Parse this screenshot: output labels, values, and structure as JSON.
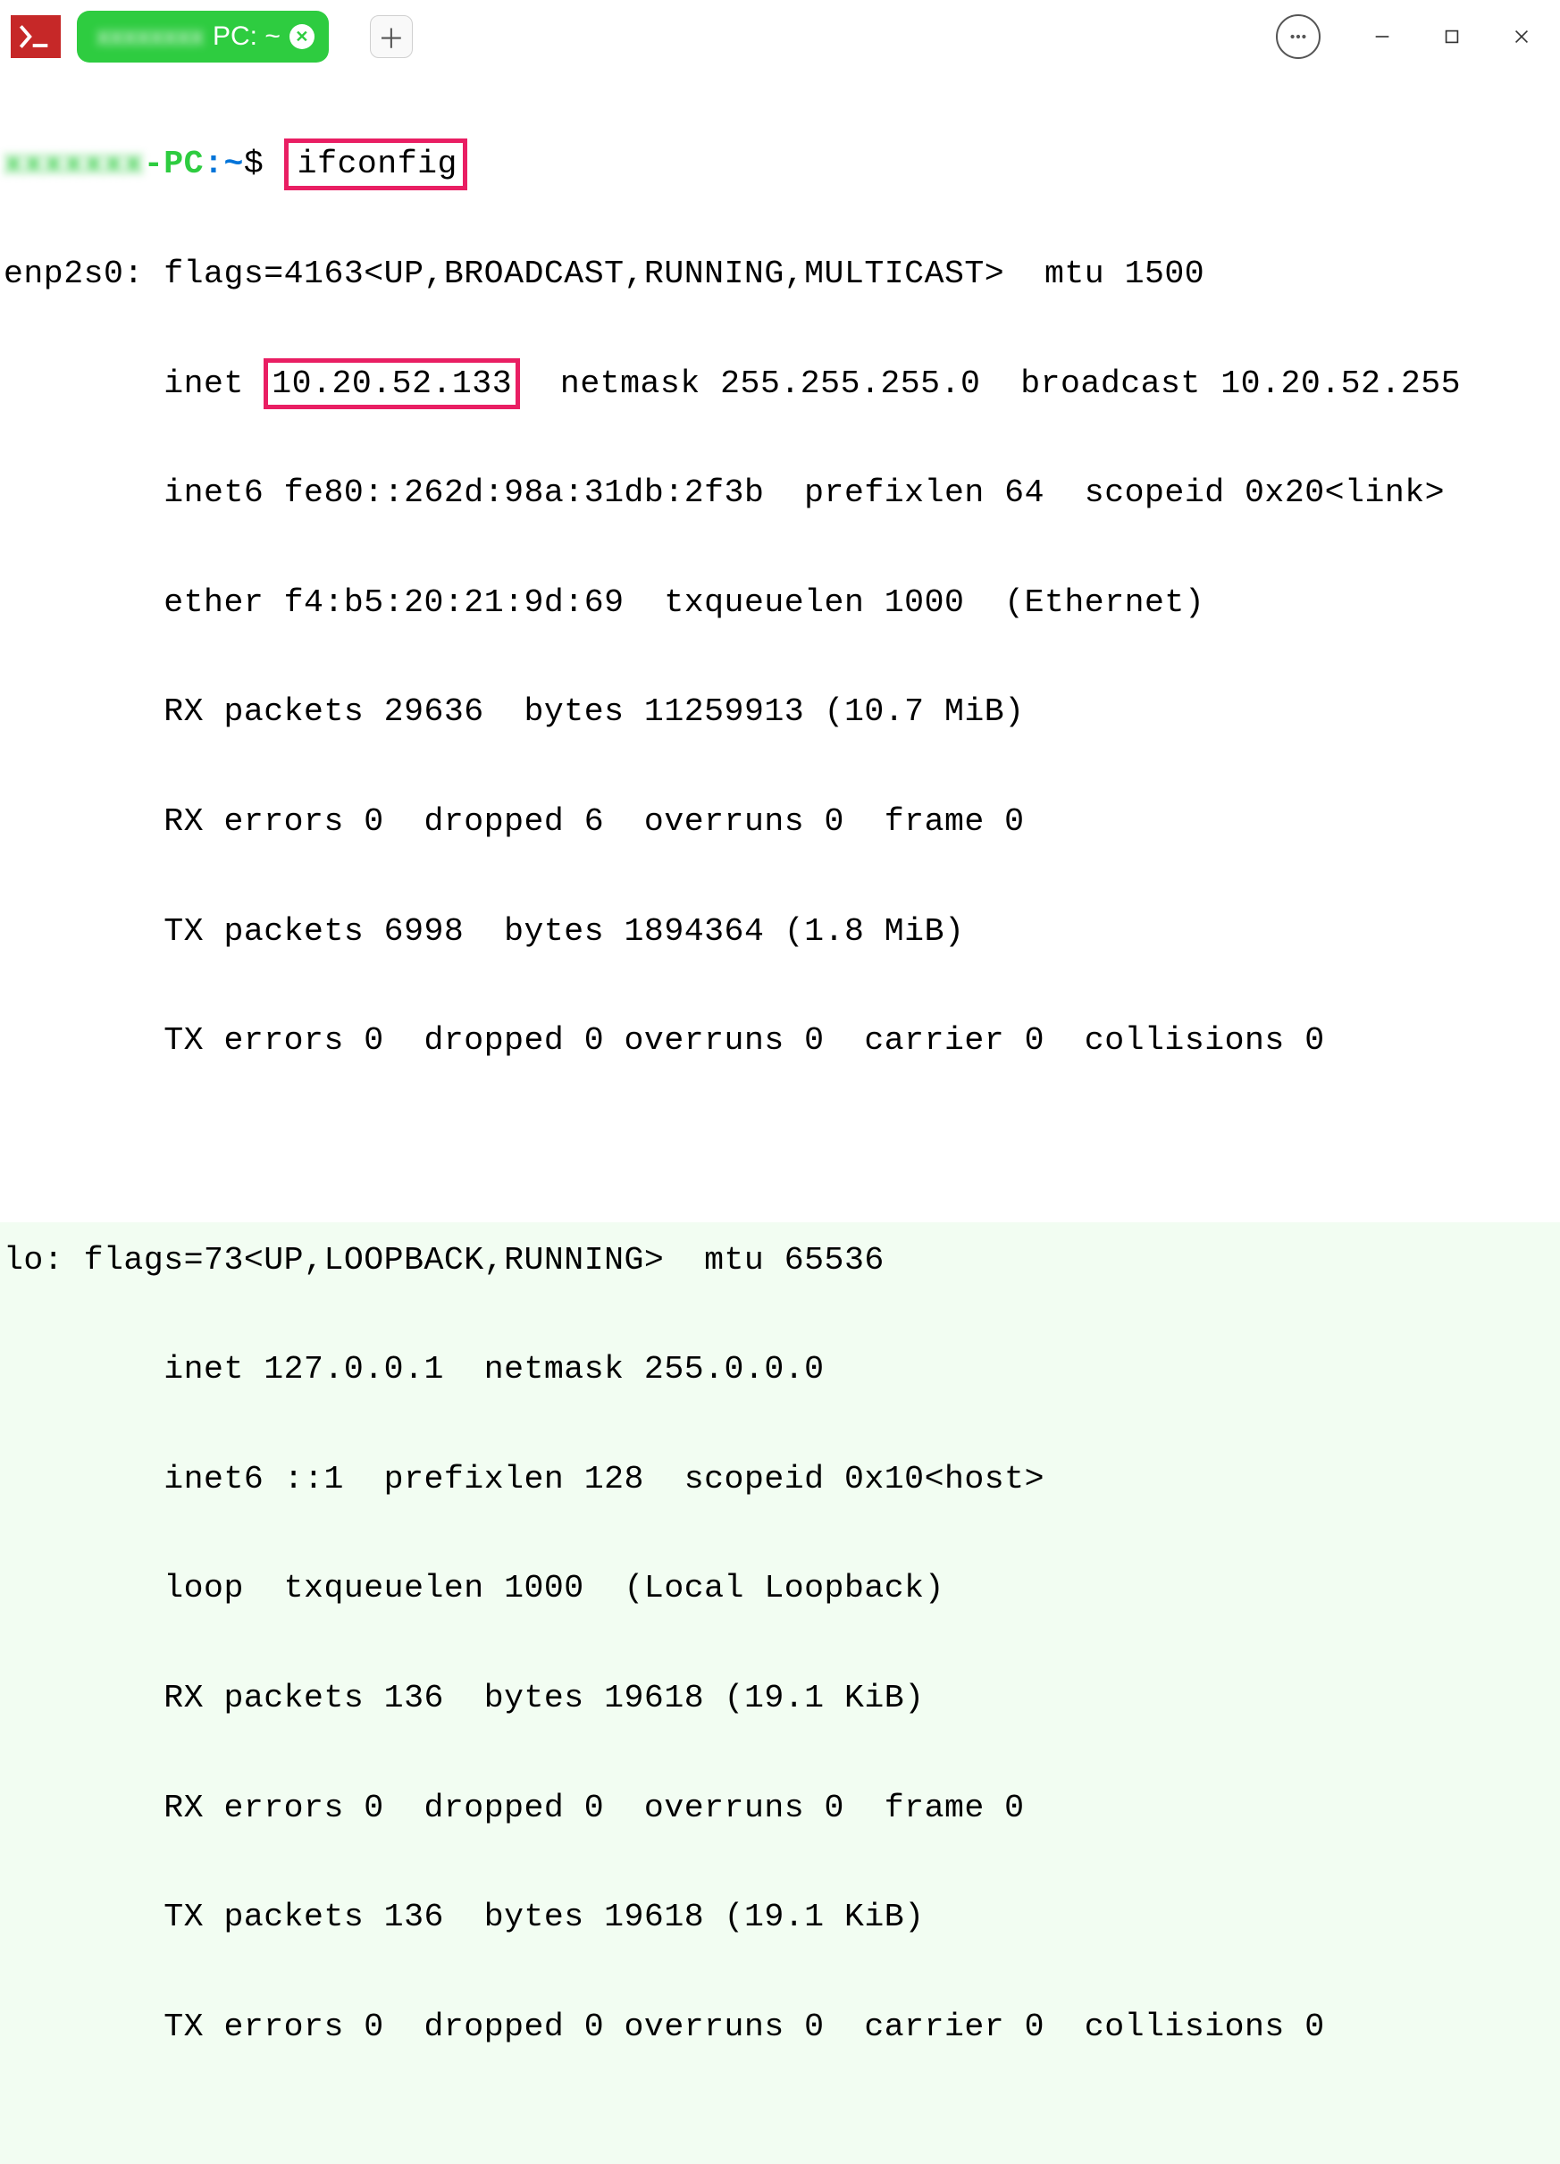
{
  "tab": {
    "label_blur": "xxxxxxxx",
    "label_clear": "PC: ~",
    "close_glyph": "✕"
  },
  "new_tab_glyph": "＋",
  "prompt": {
    "user_blur": "xxxxxxx",
    "pc": "-PC",
    "colon": ":",
    "path": "~",
    "dollar": "$"
  },
  "command": "ifconfig",
  "highlight_ip": "10.20.52.133",
  "ifconfig": {
    "enp2s0": {
      "header": "enp2s0: flags=4163<UP,BROADCAST,RUNNING,MULTICAST>  mtu 1500",
      "inet_prefix": "        inet ",
      "inet_rest": "  netmask 255.255.255.0  broadcast 10.20.52.255",
      "inet6": "        inet6 fe80::262d:98a:31db:2f3b  prefixlen 64  scopeid 0x20<link>",
      "ether": "        ether f4:b5:20:21:9d:69  txqueuelen 1000  (Ethernet)",
      "rx_packets": "        RX packets 29636  bytes 11259913 (10.7 MiB)",
      "rx_errors": "        RX errors 0  dropped 6  overruns 0  frame 0",
      "tx_packets": "        TX packets 6998  bytes 1894364 (1.8 MiB)",
      "tx_errors": "        TX errors 0  dropped 0 overruns 0  carrier 0  collisions 0"
    },
    "lo": {
      "header": "lo: flags=73<UP,LOOPBACK,RUNNING>  mtu 65536",
      "inet": "        inet 127.0.0.1  netmask 255.0.0.0",
      "inet6": "        inet6 ::1  prefixlen 128  scopeid 0x10<host>",
      "loop": "        loop  txqueuelen 1000  (Local Loopback)",
      "rx_packets": "        RX packets 136  bytes 19618 (19.1 KiB)",
      "rx_errors": "        RX errors 0  dropped 0  overruns 0  frame 0",
      "tx_packets": "        TX packets 136  bytes 19618 (19.1 KiB)",
      "tx_errors": "        TX errors 0  dropped 0 overruns 0  carrier 0  collisions 0"
    }
  }
}
